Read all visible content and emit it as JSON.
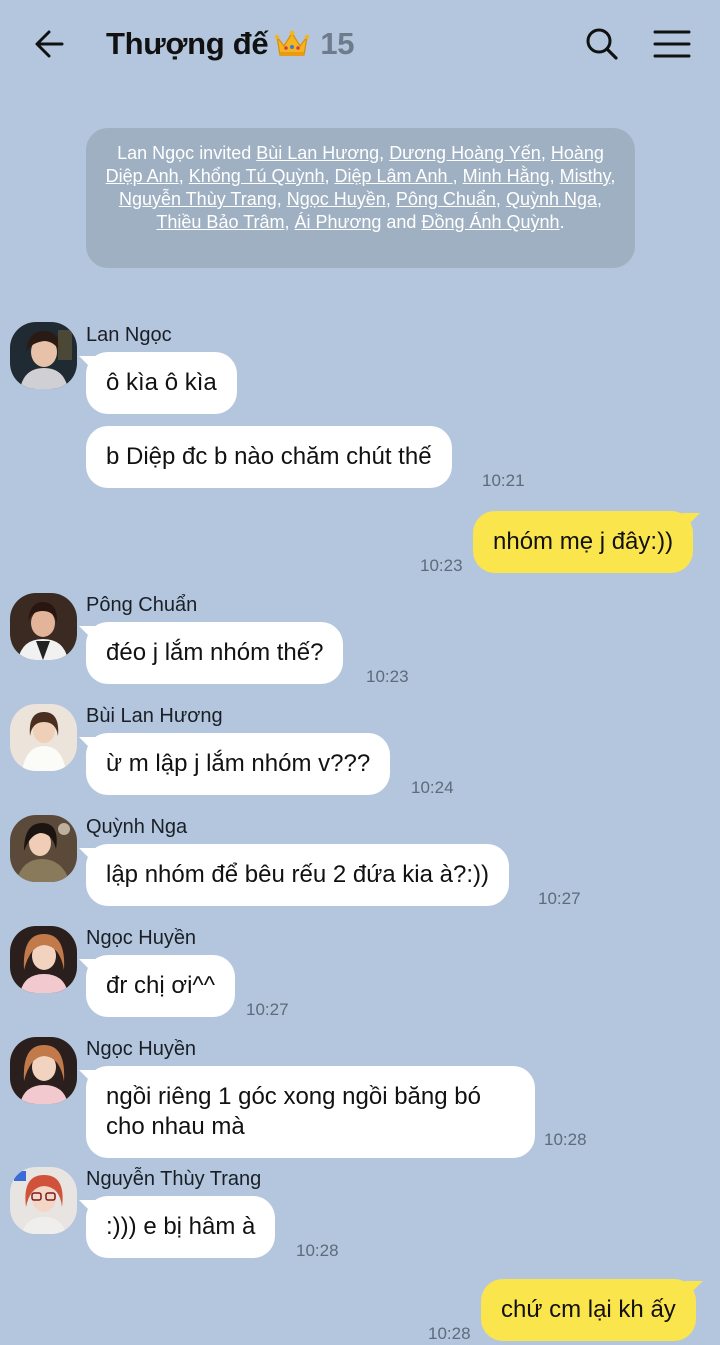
{
  "header": {
    "title": "Thượng đế",
    "member_count": "15",
    "icons": [
      "back-arrow-icon",
      "crown-emoji",
      "search-icon",
      "menu-icon"
    ]
  },
  "system_message": {
    "inviter": "Lan Ngọc",
    "verb": "invited",
    "invitees": [
      "Bùi Lan Hương",
      "Dương Hoàng Yến",
      "Hoàng Diệp Anh",
      "Khổng Tú Quỳnh",
      "Diệp Lâm Anh ",
      "Minh Hằng",
      "Misthy",
      "Nguyễn Thùy Trang",
      "Ngọc Huyền",
      "Pông Chuẩn",
      "Quỳnh Nga",
      "Thiều Bảo Trâm",
      "Ái Phương",
      "Đồng Ánh Quỳnh"
    ],
    "conjunction": "and"
  },
  "messages": [
    {
      "direction": "in",
      "sender": "Lan Ngọc",
      "text": "ô kìa ô kìa",
      "time": ""
    },
    {
      "direction": "in",
      "sender": "",
      "text": "b Diệp đc b nào chăm chút thế",
      "time": "10:21"
    },
    {
      "direction": "out",
      "sender": "",
      "text": "nhóm mẹ j đây:))",
      "time": "10:23"
    },
    {
      "direction": "in",
      "sender": "Pông Chuẩn",
      "text": "đéo j lắm nhóm thế?",
      "time": "10:23"
    },
    {
      "direction": "in",
      "sender": "Bùi Lan Hương",
      "text": "ừ m lập j lắm nhóm v???",
      "time": "10:24"
    },
    {
      "direction": "in",
      "sender": "Quỳnh Nga",
      "text": "lập nhóm để bêu rếu 2 đứa kia à?:))",
      "time": "10:27"
    },
    {
      "direction": "in",
      "sender": "Ngọc Huyền",
      "text": "đr chị ơi^^",
      "time": "10:27"
    },
    {
      "direction": "in",
      "sender": "Ngọc Huyền",
      "text": "ngồi riêng 1 góc xong ngồi băng bó cho nhau mà",
      "time": "10:28"
    },
    {
      "direction": "in",
      "sender": "Nguyễn Thùy Trang",
      "text": ":))) e bị hâm à",
      "time": "10:28"
    },
    {
      "direction": "out",
      "sender": "",
      "text": "chứ cm lại kh ấy",
      "time": "10:28"
    }
  ],
  "colors": {
    "background": "#b3c6dd",
    "incoming_bubble": "#ffffff",
    "outgoing_bubble": "#fbe54d",
    "system_bubble": "#9fb0c2"
  }
}
